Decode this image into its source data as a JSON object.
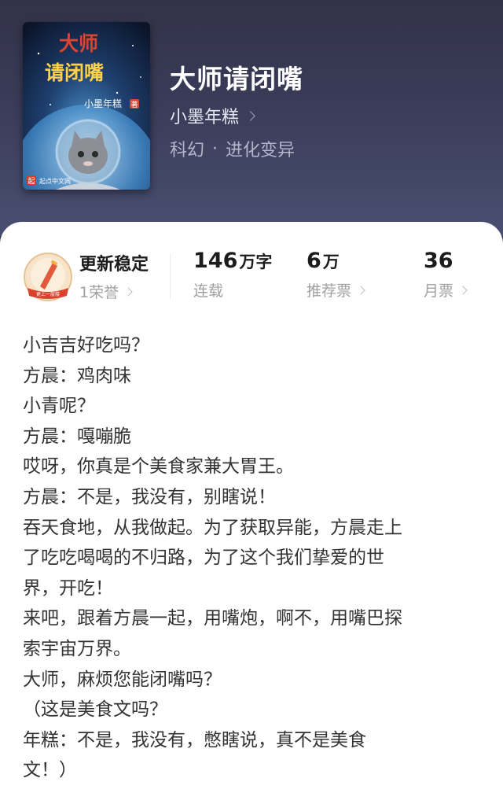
{
  "book": {
    "title": "大师请闭嘴",
    "author": "小墨年糕",
    "category": "科幻",
    "separator": "·",
    "subcategory": "进化变异",
    "cover": {
      "title_line1": "大师",
      "title_line2": "请闭嘴",
      "author": "小墨年糕",
      "badge": "著",
      "publisher": "起点中文网",
      "publisher_mark": "起",
      "accent": "#d94533"
    }
  },
  "stats": {
    "honor": {
      "title": "更新稳定",
      "subtitle": "1荣誉",
      "badge_text": "更上一层楼"
    },
    "word_count": {
      "number": "146",
      "unit": "万字",
      "label": "连载"
    },
    "recommend_tickets": {
      "number": "6",
      "unit": "万",
      "label": "推荐票"
    },
    "monthly_tickets": {
      "number": "36",
      "unit": "",
      "label": "月票"
    }
  },
  "synopsis": [
    "小吉吉好吃吗？",
    "方晨：鸡肉味",
    "小青呢？",
    "方晨：嘎嘣脆",
    "哎呀，你真是个美食家兼大胃王。",
    "方晨：不是，我没有，别瞎说！",
    "吞天食地，从我做起。为了获取异能，方晨走上",
    "了吃吃喝喝的不归路，为了这个我们挚爱的世",
    "界，开吃！",
    "来吧，跟着方晨一起，用嘴炮，啊不，用嘴巴探",
    "索宇宙万界。",
    "大师，麻烦您能闭嘴吗？",
    "（这是美食文吗？",
    "年糕：不是，我没有，憋瞎说，真不是美食",
    "文！）"
  ],
  "colors": {
    "hero_bg": "#3a3c58",
    "card_bg": "#ffffff",
    "text_primary": "#1c1c1c",
    "text_secondary": "#a0a0a0"
  },
  "icons": {
    "author_chevron": "chevron-right-icon",
    "honor_badge": "medal-icon"
  }
}
